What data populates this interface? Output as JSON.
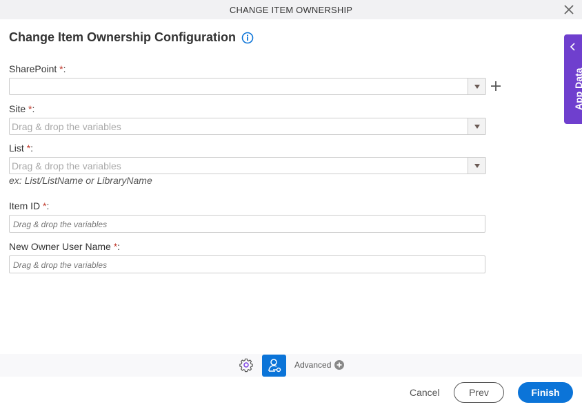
{
  "window": {
    "title": "CHANGE ITEM OWNERSHIP",
    "close_icon": "close-icon"
  },
  "heading": {
    "title": "Change Item Ownership Configuration",
    "info_icon": "info-icon"
  },
  "fields": {
    "sharepoint": {
      "label": "SharePoint",
      "required": "*",
      "suffix": ":",
      "value": "",
      "placeholder": ""
    },
    "site": {
      "label": "Site",
      "required": "*",
      "suffix": ":",
      "placeholder": "Drag & drop the variables"
    },
    "list": {
      "label": "List",
      "required": "*",
      "suffix": ":",
      "placeholder": "Drag & drop the variables",
      "hint": "ex: List/ListName or LibraryName"
    },
    "item_id": {
      "label": "Item ID",
      "required": "*",
      "suffix": ":",
      "placeholder": "Drag & drop the variables"
    },
    "new_owner": {
      "label": "New Owner User Name",
      "required": "*",
      "suffix": ":",
      "placeholder": "Drag & drop the variables"
    }
  },
  "side_panel": {
    "label": "App Data"
  },
  "toolbar": {
    "advanced_label": "Advanced"
  },
  "footer": {
    "cancel": "Cancel",
    "prev": "Prev",
    "finish": "Finish"
  },
  "colors": {
    "accent": "#0b74d8",
    "side_panel": "#6f3fce",
    "required": "#c0392b",
    "gear_inner": "#7b3fe4"
  }
}
